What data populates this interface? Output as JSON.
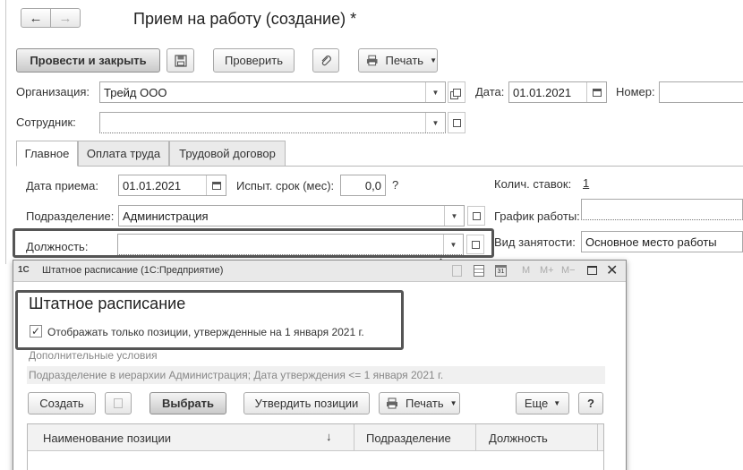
{
  "title": "Прием на работу (создание) *",
  "toolbar": {
    "post_close": "Провести и закрыть",
    "check": "Проверить",
    "print": "Печать"
  },
  "fields": {
    "org_label": "Организация:",
    "org_value": "Трейд ООО",
    "date_label": "Дата:",
    "date_value": "01.01.2021",
    "number_label": "Номер:",
    "employee_label": "Сотрудник:"
  },
  "tabs": [
    "Главное",
    "Оплата труда",
    "Трудовой договор"
  ],
  "main": {
    "hire_date_label": "Дата приема:",
    "hire_date_value": "01.01.2021",
    "probation_label": "Испыт. срок (мес):",
    "probation_value": "0,0",
    "help": "?",
    "rate_label": "Колич. ставок:",
    "rate_value": "1",
    "dept_label": "Подразделение:",
    "dept_value": "Администрация",
    "schedule_label": "График работы:",
    "position_label": "Должность:",
    "employment_label": "Вид занятости:",
    "employment_value": "Основное место работы"
  },
  "popup": {
    "window_title": "Штатное расписание  (1С:Предприятие)",
    "app_badge": "1С",
    "heading": "Штатное расписание",
    "checkbox_label": "Отображать только позиции, утвержденные на 1 января 2021 г.",
    "checkbox_checked": true,
    "extra_conditions": "Дополнительные условия",
    "filter_text": "Подразделение в иерархии Администрация; Дата утверждения <= 1 января 2021 г.",
    "create": "Создать",
    "select": "Выбрать",
    "approve": "Утвердить позиции",
    "print": "Печать",
    "more": "Еще",
    "help": "?",
    "tb_icons": [
      "M",
      "M+",
      "M−"
    ],
    "columns": [
      "Наименование позиции",
      "Подразделение",
      "Должность"
    ],
    "sort_arrow": "↓"
  }
}
